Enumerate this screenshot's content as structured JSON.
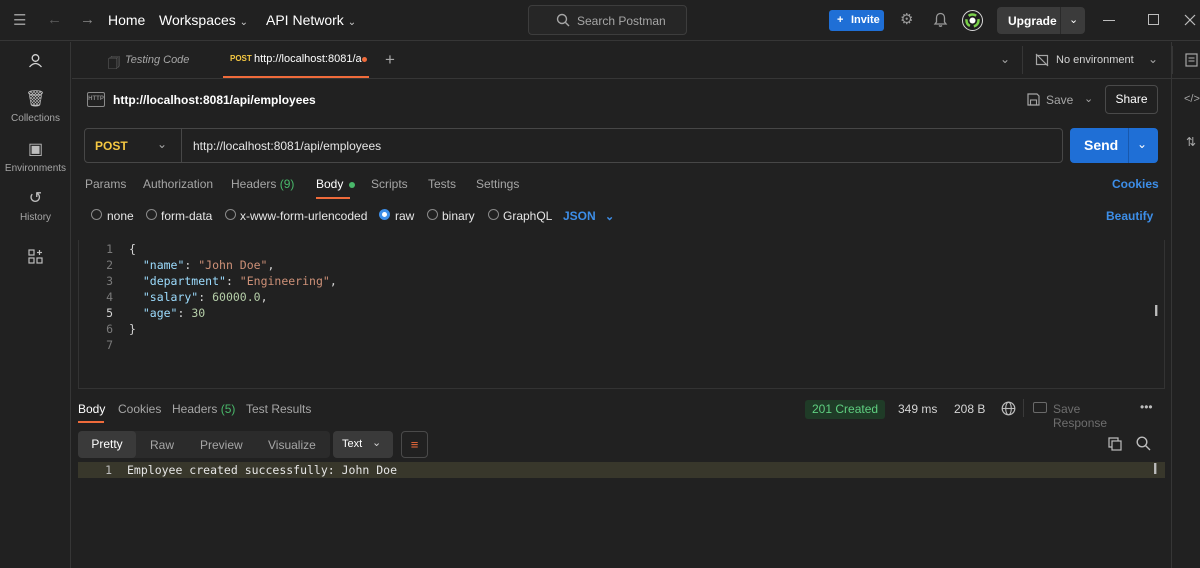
{
  "topbar": {
    "home": "Home",
    "workspaces": "Workspaces",
    "api_network": "API Network",
    "search_placeholder": "Search Postman",
    "invite": "Invite",
    "upgrade": "Upgrade"
  },
  "sidebar": {
    "items": [
      {
        "label": "Collections",
        "icon": "collections-icon"
      },
      {
        "label": "Environments",
        "icon": "environments-icon"
      },
      {
        "label": "History",
        "icon": "history-icon"
      }
    ]
  },
  "tabs": {
    "items": [
      {
        "label": "Testing Code",
        "method": ""
      },
      {
        "label": "http://localhost:8081/a",
        "method": "POST"
      }
    ],
    "environment": "No environment"
  },
  "request": {
    "name": "http://localhost:8081/api/employees",
    "save": "Save",
    "share": "Share",
    "method": "POST",
    "url": "http://localhost:8081/api/employees",
    "send": "Send",
    "tabs": {
      "params": "Params",
      "authorization": "Authorization",
      "headers": "Headers",
      "headers_count": "(9)",
      "body": "Body",
      "scripts": "Scripts",
      "tests": "Tests",
      "settings": "Settings"
    },
    "cookies": "Cookies",
    "body_types": [
      "none",
      "form-data",
      "x-www-form-urlencoded",
      "raw",
      "binary",
      "GraphQL"
    ],
    "selected_body_type": "raw",
    "format": "JSON",
    "beautify": "Beautify",
    "code_lines": [
      "{",
      "  \"name\": \"John Doe\",",
      "  \"department\": \"Engineering\",",
      "  \"salary\": 60000.0,",
      "  \"age\": 30",
      "}",
      ""
    ]
  },
  "response": {
    "tabs": {
      "body": "Body",
      "cookies": "Cookies",
      "headers": "Headers",
      "headers_count": "(5)",
      "test_results": "Test Results"
    },
    "status": "201 Created",
    "time": "349 ms",
    "size": "208 B",
    "save_response": "Save Response",
    "view_tabs": [
      "Pretty",
      "Raw",
      "Preview",
      "Visualize"
    ],
    "format": "Text",
    "line_number": "1",
    "body": "Employee created successfully: John Doe"
  },
  "colors": {
    "accent": "#1f6fd6",
    "method_post": "#f5c842",
    "status_ok": "#5fcf80",
    "tab_active": "#ef6b3b"
  }
}
